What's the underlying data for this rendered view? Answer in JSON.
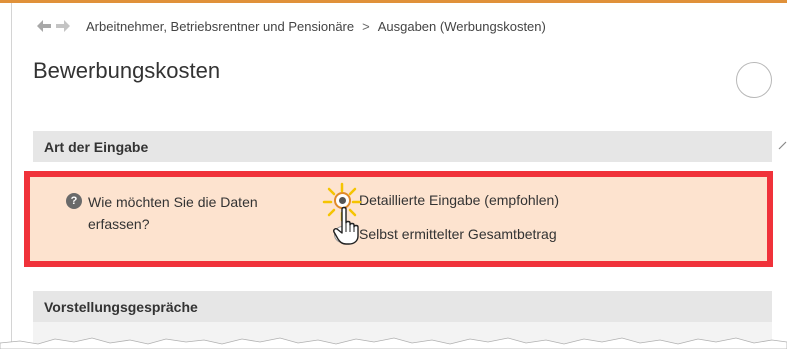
{
  "breadcrumb": {
    "items": [
      "Arbeitnehmer, Betriebsrentner und Pensionäre",
      "Ausgaben (Werbungskosten)"
    ],
    "separator": ">"
  },
  "page": {
    "title": "Bewerbungskosten"
  },
  "sections": [
    {
      "title": "Art der Eingabe"
    },
    {
      "title": "Vorstellungsgespräche"
    }
  ],
  "question": {
    "text": "Wie möchten Sie die Daten erfassen?",
    "options": [
      {
        "label": "Detaillierte Eingabe (empfohlen)",
        "selected": true
      },
      {
        "label": "Selbst ermittelter Gesamtbetrag",
        "selected": false
      }
    ]
  },
  "colors": {
    "accent": "#e0913a",
    "highlight_border": "#f0323a",
    "highlight_fill": "#fde3cf",
    "section_header": "#e6e6e6"
  }
}
